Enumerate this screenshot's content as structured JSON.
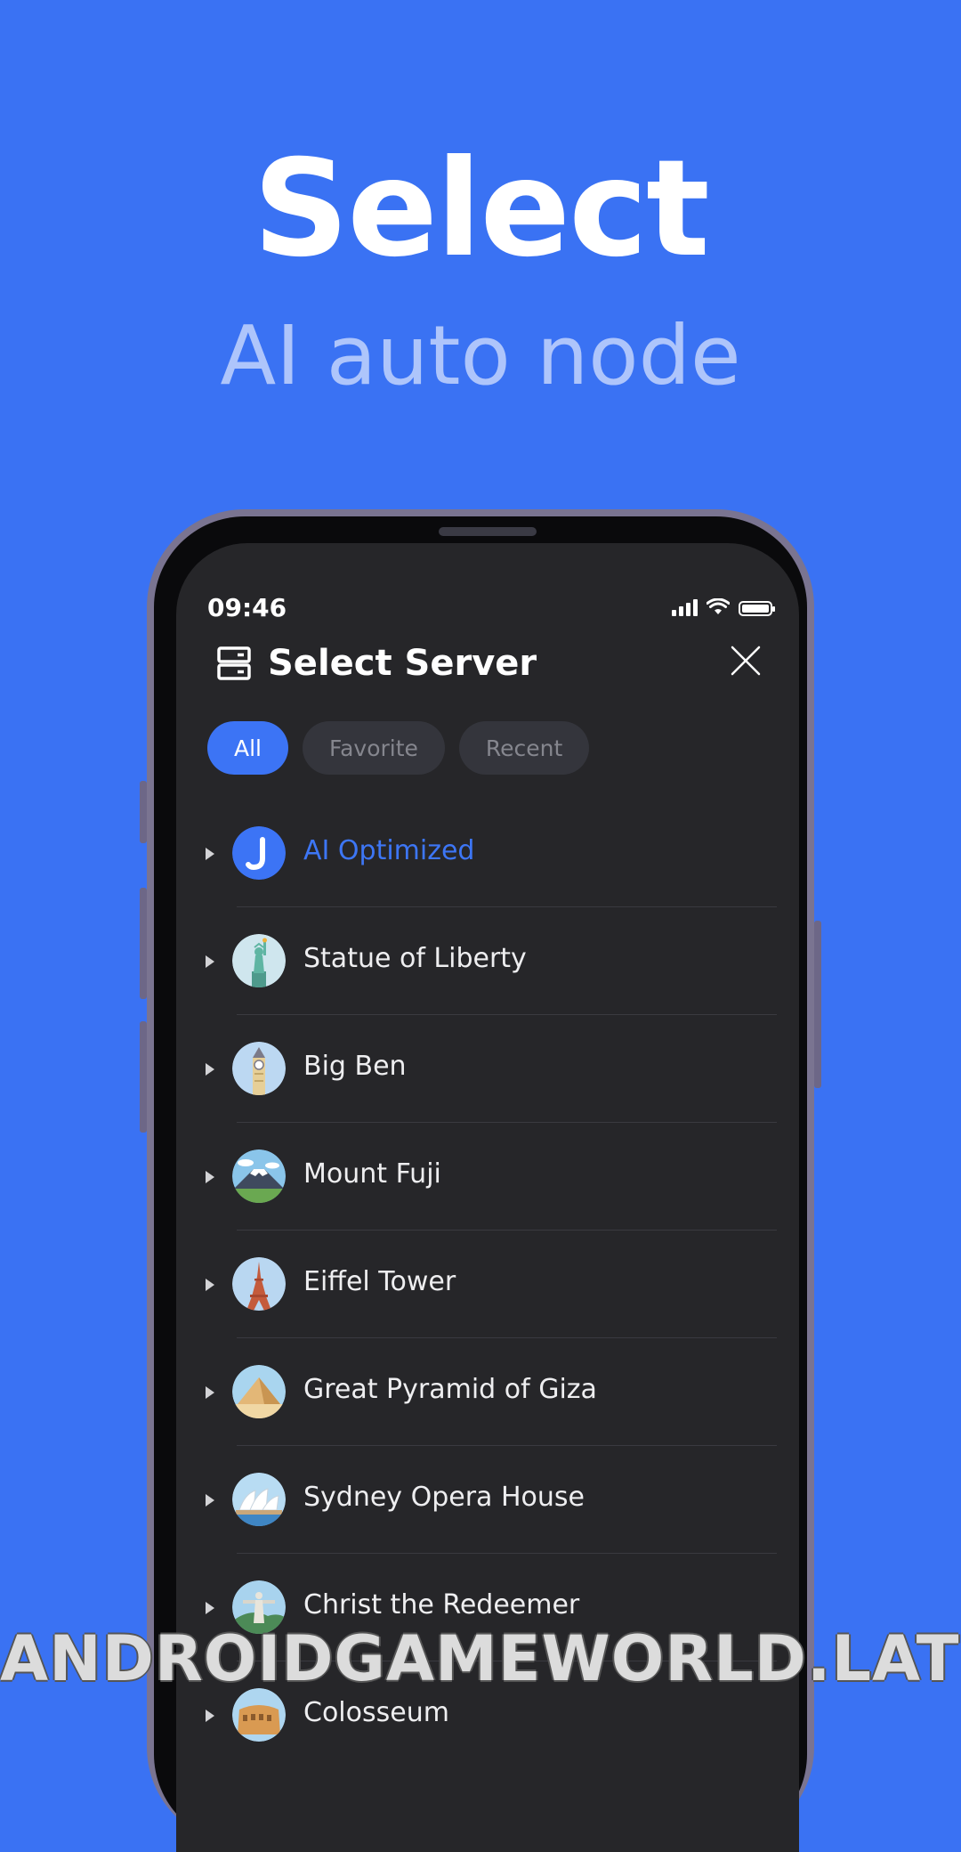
{
  "headline": "Select",
  "subheadline": "AI auto node",
  "status_bar": {
    "time": "09:46"
  },
  "header": {
    "title": "Select Server"
  },
  "tabs": [
    {
      "label": "All",
      "active": true
    },
    {
      "label": "Favorite",
      "active": false
    },
    {
      "label": "Recent",
      "active": false
    }
  ],
  "servers": [
    {
      "label": "AI Optimized",
      "icon": "ai-logo-icon",
      "highlighted": true
    },
    {
      "label": "Statue of Liberty",
      "icon": "statue-of-liberty-icon"
    },
    {
      "label": "Big Ben",
      "icon": "big-ben-icon"
    },
    {
      "label": "Mount Fuji",
      "icon": "mount-fuji-icon"
    },
    {
      "label": "Eiffel Tower",
      "icon": "eiffel-tower-icon"
    },
    {
      "label": "Great Pyramid of Giza",
      "icon": "pyramid-icon"
    },
    {
      "label": "Sydney Opera House",
      "icon": "opera-house-icon"
    },
    {
      "label": "Christ the Redeemer",
      "icon": "christ-redeemer-icon"
    },
    {
      "label": "Colosseum",
      "icon": "colosseum-icon"
    }
  ],
  "watermark": "ANDROIDGAMEWORLD.LAT",
  "colors": {
    "background": "#3a72f3",
    "accent": "#3c74f5",
    "panel": "#262629"
  }
}
